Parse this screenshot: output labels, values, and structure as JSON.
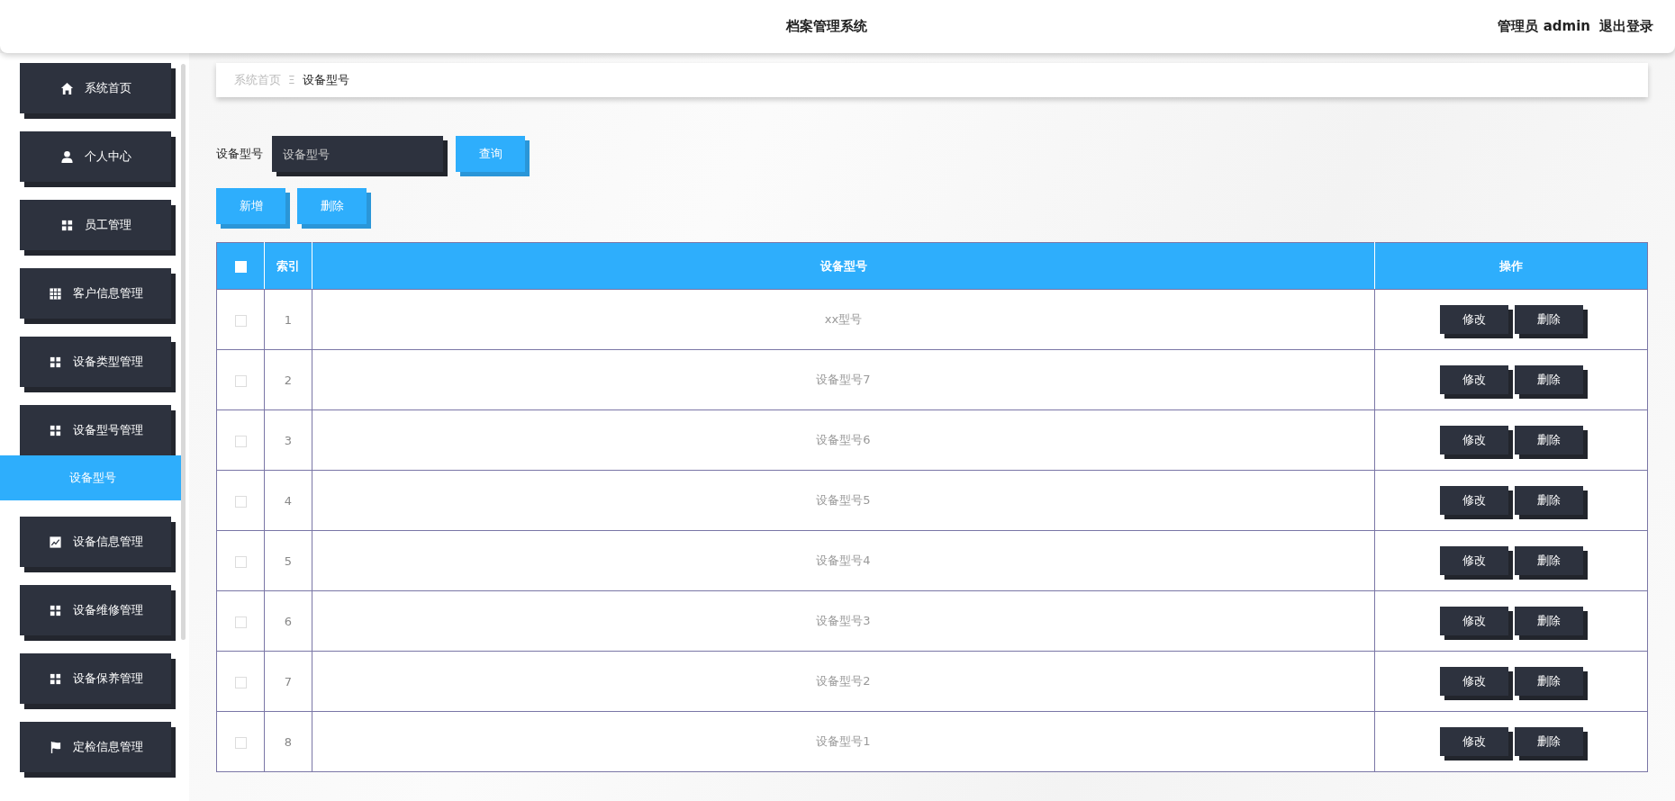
{
  "header": {
    "title": "档案管理系统",
    "user": "管理员 admin",
    "logout": "退出登录"
  },
  "sidebar": {
    "items": [
      {
        "label": "系统首页",
        "expanded": false
      },
      {
        "label": "个人中心",
        "expanded": false
      },
      {
        "label": "员工管理",
        "expanded": false
      },
      {
        "label": "客户信息管理",
        "expanded": false
      },
      {
        "label": "设备类型管理",
        "expanded": false
      },
      {
        "label": "设备型号管理",
        "expanded": true,
        "children": [
          {
            "label": "设备型号",
            "selected": true
          }
        ]
      },
      {
        "label": "设备信息管理",
        "expanded": false
      },
      {
        "label": "设备维修管理",
        "expanded": false
      },
      {
        "label": "设备保养管理",
        "expanded": false
      },
      {
        "label": "定检信息管理",
        "expanded": false
      }
    ]
  },
  "breadcrumb": {
    "home": "系统首页",
    "separator": "Ξ",
    "current": "设备型号"
  },
  "search": {
    "label": "设备型号",
    "placeholder": "设备型号",
    "button": "查询"
  },
  "actions": [
    "新增",
    "删除"
  ],
  "table": {
    "select_all_checked": false,
    "columns": [
      "索引",
      "设备型号",
      "操作"
    ],
    "rows": [
      {
        "checked": false,
        "index": "1",
        "model": "xx型号",
        "edit": "修改",
        "delete": "删除"
      },
      {
        "checked": false,
        "index": "2",
        "model": "设备型号7",
        "edit": "修改",
        "delete": "删除"
      },
      {
        "checked": false,
        "index": "3",
        "model": "设备型号6",
        "edit": "修改",
        "delete": "删除"
      },
      {
        "checked": false,
        "index": "4",
        "model": "设备型号5",
        "edit": "修改",
        "delete": "删除"
      },
      {
        "checked": false,
        "index": "5",
        "model": "设备型号4",
        "edit": "修改",
        "delete": "删除"
      },
      {
        "checked": false,
        "index": "6",
        "model": "设备型号3",
        "edit": "修改",
        "delete": "删除"
      },
      {
        "checked": false,
        "index": "7",
        "model": "设备型号2",
        "edit": "修改",
        "delete": "删除"
      },
      {
        "checked": false,
        "index": "8",
        "model": "设备型号1",
        "edit": "修改",
        "delete": "删除"
      }
    ]
  }
}
